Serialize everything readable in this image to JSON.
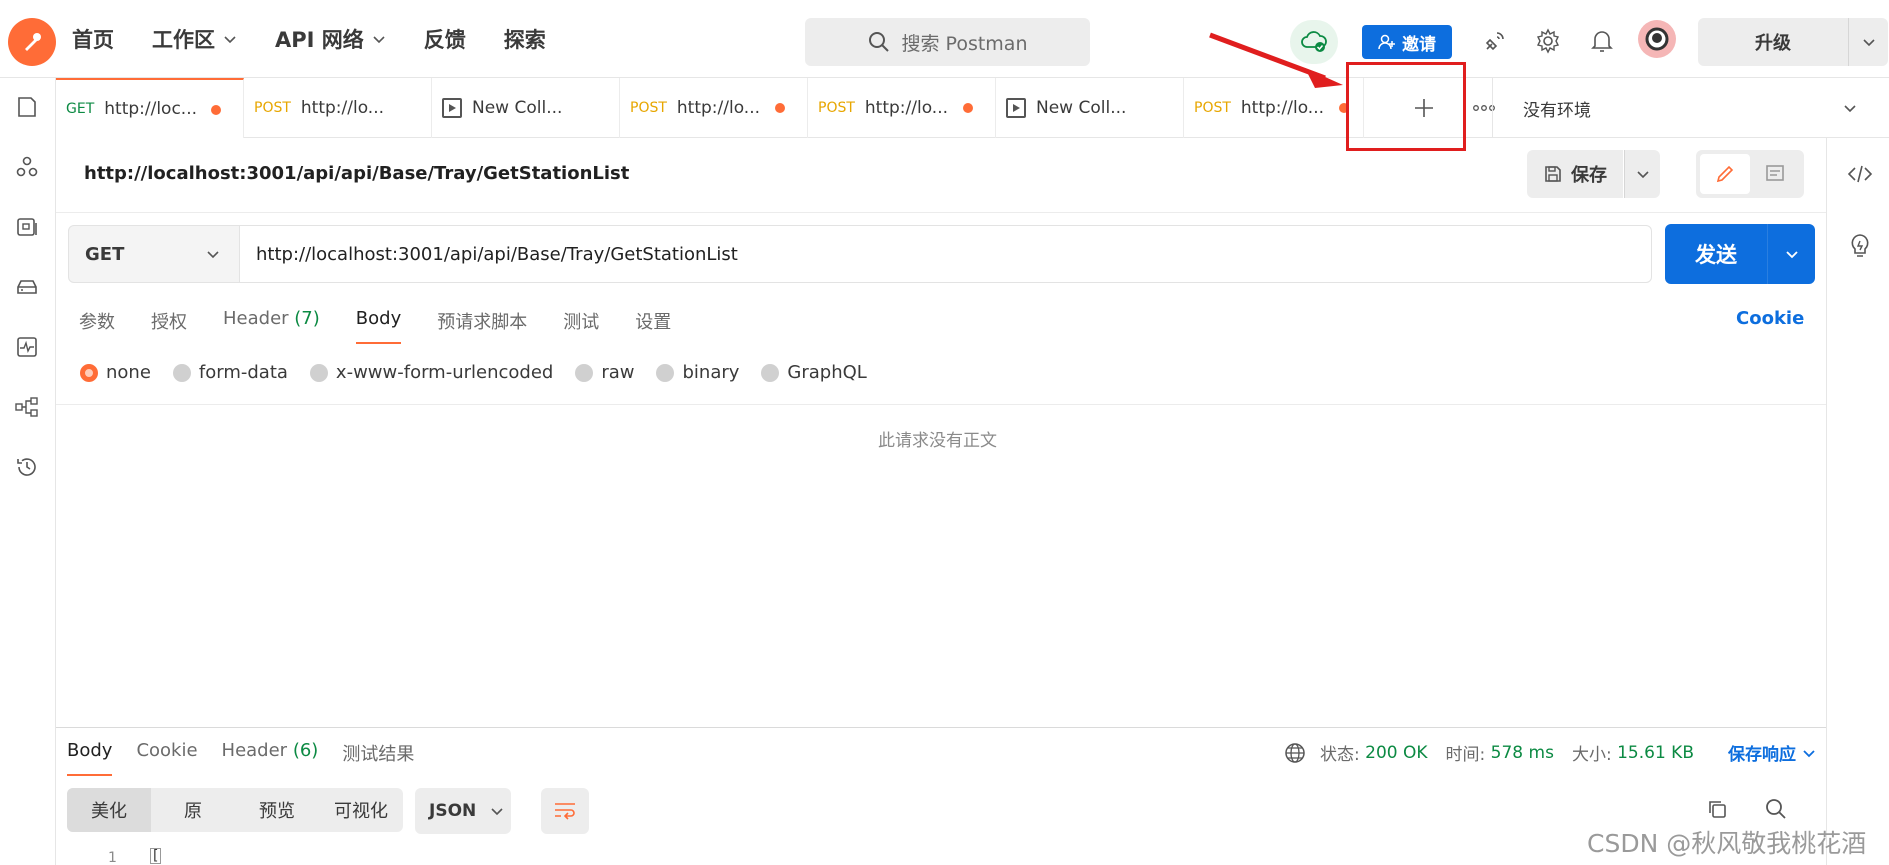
{
  "nav": {
    "home": "首页",
    "workspace": "工作区",
    "api_network": "API 网络",
    "feedback": "反馈",
    "explore": "探索"
  },
  "search": {
    "placeholder": "搜索 Postman"
  },
  "invite_label": "邀请",
  "upgrade_label": "升级",
  "tabs": [
    {
      "method": "GET",
      "name": "http://loc...",
      "unsaved": true,
      "type": "request"
    },
    {
      "method": "POST",
      "name": "http://lo...",
      "unsaved": false,
      "type": "request"
    },
    {
      "method": "",
      "name": "New Coll...",
      "unsaved": false,
      "type": "collection"
    },
    {
      "method": "POST",
      "name": "http://lo...",
      "unsaved": true,
      "type": "request"
    },
    {
      "method": "POST",
      "name": "http://lo...",
      "unsaved": true,
      "type": "request"
    },
    {
      "method": "",
      "name": "New Coll...",
      "unsaved": false,
      "type": "collection"
    },
    {
      "method": "POST",
      "name": "http://lo...",
      "unsaved": true,
      "type": "request"
    }
  ],
  "environment": {
    "label": "没有环境"
  },
  "request": {
    "title": "http://localhost:3001/api/api/Base/Tray/GetStationList",
    "save_label": "保存",
    "method": "GET",
    "url": "http://localhost:3001/api/api/Base/Tray/GetStationList",
    "send_label": "发送",
    "tabs": {
      "params": "参数",
      "auth": "授权",
      "header": "Header",
      "header_count": "(7)",
      "body": "Body",
      "pre_script": "预请求脚本",
      "tests": "测试",
      "settings": "设置"
    },
    "cookie_link": "Cookie",
    "body_types": {
      "none": "none",
      "form_data": "form-data",
      "urlencoded": "x-www-form-urlencoded",
      "raw": "raw",
      "binary": "binary",
      "graphql": "GraphQL"
    },
    "selected_body_type": "none",
    "empty_body_text": "此请求没有正文"
  },
  "response": {
    "tabs": {
      "body": "Body",
      "cookie": "Cookie",
      "header": "Header",
      "header_count": "(6)",
      "test_results": "测试结果"
    },
    "status_label": "状态:",
    "status_value": "200 OK",
    "time_label": "时间:",
    "time_value": "578 ms",
    "size_label": "大小:",
    "size_value": "15.61 KB",
    "save_response": "保存响应",
    "views": {
      "pretty": "美化",
      "raw": "原",
      "preview": "预览",
      "visualize": "可视化"
    },
    "format": "JSON",
    "first_line_number": "1",
    "first_line_text": "["
  },
  "watermark": "CSDN @秋风敬我桃花酒",
  "colors": {
    "brand_orange": "#ff6c37",
    "primary_blue": "#0d6ede",
    "success_green": "#0c8a43",
    "post_yellow": "#e7a600",
    "annotation_red": "#e01e1e"
  }
}
